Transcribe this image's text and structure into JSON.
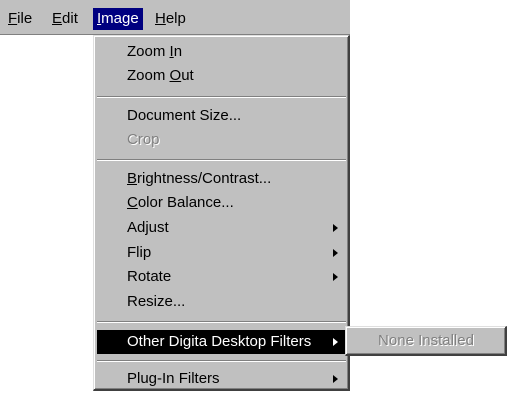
{
  "menubar": {
    "items": [
      {
        "label": "File",
        "mnemonic": "F",
        "rest": "ile"
      },
      {
        "label": "Edit",
        "mnemonic": "E",
        "rest": "dit"
      },
      {
        "label": "Image",
        "mnemonic": "I",
        "rest": "mage"
      },
      {
        "label": "Help",
        "mnemonic": "H",
        "rest": "elp"
      }
    ]
  },
  "image_menu": {
    "zoom_in": {
      "before": "Zoom ",
      "mnemonic": "I",
      "after": "n"
    },
    "zoom_out": {
      "before": "Zoom ",
      "mnemonic": "O",
      "after": "ut"
    },
    "document_size": "Document Size...",
    "crop": "Crop",
    "brightness_contrast": {
      "before": "",
      "mnemonic": "B",
      "after": "rightness/Contrast..."
    },
    "color_balance": {
      "before": "",
      "mnemonic": "C",
      "after": "olor Balance..."
    },
    "adjust": "Adjust",
    "flip": "Flip",
    "rotate": "Rotate",
    "resize": "Resize...",
    "other_filters": "Other Digita Desktop Filters",
    "plugin_filters": "Plug-In Filters"
  },
  "submenu": {
    "none_installed": "None Installed"
  },
  "colors": {
    "menu_face": "#c0c0c0",
    "highlight_bar": "#000080",
    "selected_item": "#000000",
    "disabled_text": "#808080"
  }
}
